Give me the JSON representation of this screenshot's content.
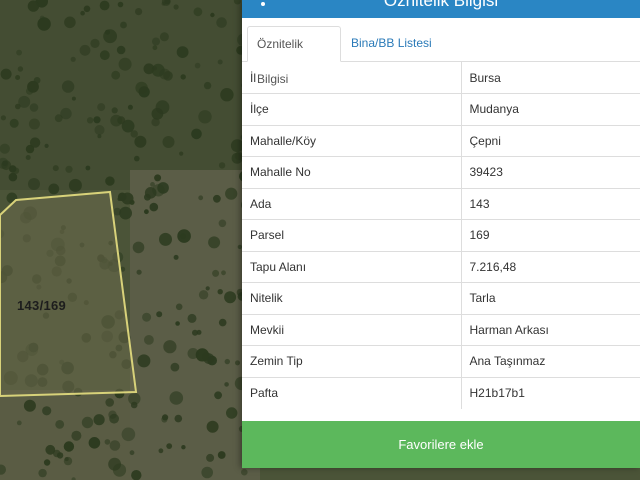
{
  "map": {
    "parcel_label": "143/169",
    "parcel_outline_color": "#d8d27a"
  },
  "panel": {
    "title": "Öznitelik Bilgisi",
    "tabs": [
      {
        "label": "Öznitelik Bilgisi",
        "active": true
      },
      {
        "label": "Bina/BB Listesi",
        "active": false
      }
    ],
    "attributes": [
      {
        "key": "İl",
        "value": "Bursa"
      },
      {
        "key": "İlçe",
        "value": "Mudanya"
      },
      {
        "key": "Mahalle/Köy",
        "value": "Çepni"
      },
      {
        "key": "Mahalle No",
        "value": "39423"
      },
      {
        "key": "Ada",
        "value": "143"
      },
      {
        "key": "Parsel",
        "value": "169"
      },
      {
        "key": "Tapu Alanı",
        "value": "7.216,48"
      },
      {
        "key": "Nitelik",
        "value": "Tarla"
      },
      {
        "key": "Mevkii",
        "value": "Harman Arkası"
      },
      {
        "key": "Zemin Tip",
        "value": "Ana Taşınmaz"
      },
      {
        "key": "Pafta",
        "value": "H21b17b1"
      }
    ],
    "favorite_button": "Favorilere ekle"
  },
  "colors": {
    "header_blue": "#2a86c4",
    "button_green": "#5cb85c",
    "tab_link": "#2a7ab8"
  }
}
